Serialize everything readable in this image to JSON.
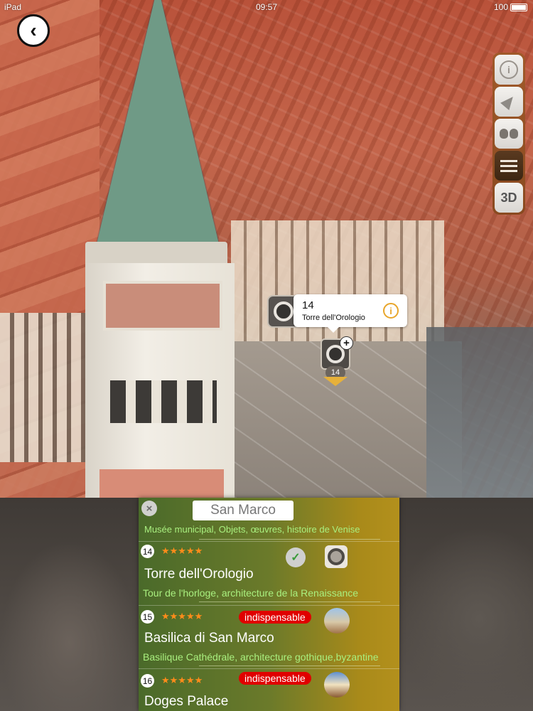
{
  "status_bar": {
    "device": "iPad",
    "time": "09:57",
    "battery": "100"
  },
  "back_button": {
    "icon": "chevron-left-icon",
    "glyph": "‹"
  },
  "toolbar": {
    "items": [
      {
        "name": "info",
        "icon": "info-icon"
      },
      {
        "name": "locate",
        "icon": "navigation-arrow-icon"
      },
      {
        "name": "explore",
        "icon": "binoculars-icon"
      },
      {
        "name": "list",
        "icon": "menu-icon",
        "active": true
      },
      {
        "name": "3d",
        "icon": "3d-icon",
        "label": "3D"
      }
    ]
  },
  "map_callout": {
    "number": "14",
    "name": "Torre dell'Orologio",
    "marker_badge": "14"
  },
  "panel": {
    "close_glyph": "×",
    "title": "San Marco",
    "top_subtitle": "Musée municipal, Objets, œuvres, histoire de Venise",
    "rows": [
      {
        "number": "14",
        "stars": "★★★★★",
        "name": "Torre dell'Orologio",
        "subtitle": "Tour de l'horloge, architecture de la Renaissance",
        "checked": true
      },
      {
        "number": "15",
        "stars": "★★★★★",
        "badge": "indispensable",
        "name": "Basilica di San Marco",
        "subtitle": "Basilique Cathédrale, architecture gothique,byzantine"
      },
      {
        "number": "16",
        "stars": "★★★★★",
        "badge": "indispensable",
        "name": "Doges Palace"
      }
    ]
  },
  "colors": {
    "accent_orange": "#e8a62b",
    "badge_red": "#e00000",
    "subtitle_green": "#a9ef7f",
    "star_orange": "#ff8c1a"
  }
}
